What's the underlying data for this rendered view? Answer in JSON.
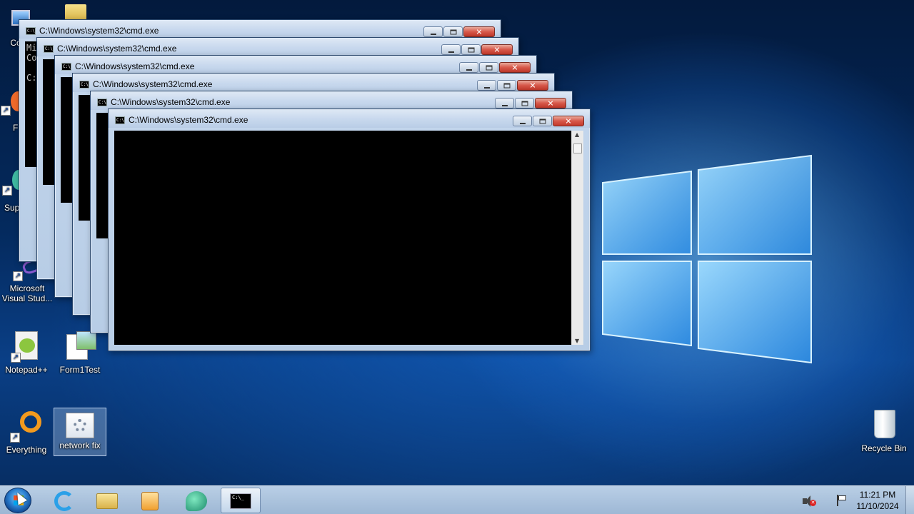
{
  "desktop": {
    "icons": [
      {
        "label": "Co",
        "icon": "computer-icon"
      },
      {
        "label": "F",
        "icon": "browser-icon"
      },
      {
        "label": "Sup",
        "icon": "support-icon"
      },
      {
        "label": "Microsoft Visual Stud...",
        "icon": "visual-studio-icon"
      },
      {
        "label": "Notepad++",
        "icon": "notepad-plus-plus-icon"
      },
      {
        "label": "Form1Test",
        "icon": "form-app-icon"
      },
      {
        "label": "Everything",
        "icon": "everything-search-icon"
      },
      {
        "label": "network fix",
        "icon": "batch-file-icon"
      },
      {
        "label": "Recycle Bin",
        "icon": "recycle-bin-icon"
      }
    ]
  },
  "windows": [
    {
      "title": "C:\\Windows\\system32\\cmd.exe",
      "console": "Mi\nCo\n\nC:"
    },
    {
      "title": "C:\\Windows\\system32\\cmd.exe",
      "console": ""
    },
    {
      "title": "C:\\Windows\\system32\\cmd.exe",
      "console": ""
    },
    {
      "title": "C:\\Windows\\system32\\cmd.exe",
      "console": ""
    },
    {
      "title": "C:\\Windows\\system32\\cmd.exe",
      "console": ""
    },
    {
      "title": "C:\\Windows\\system32\\cmd.exe",
      "console": ""
    }
  ],
  "taskbar": {
    "start": "start-orb-icon",
    "pinned": [
      {
        "name": "internet-explorer-icon"
      },
      {
        "name": "file-explorer-icon"
      },
      {
        "name": "media-player-icon"
      },
      {
        "name": "app-icon"
      },
      {
        "name": "cmd-icon"
      }
    ],
    "tray": {
      "volume": "speaker-muted-icon",
      "action_center": "flag-icon"
    },
    "time": "11:21 PM",
    "date": "11/10/2024"
  },
  "colors": {
    "accent": "#1f6fd1",
    "titlebar": "#c9d9ee",
    "close": "#c3392b"
  }
}
